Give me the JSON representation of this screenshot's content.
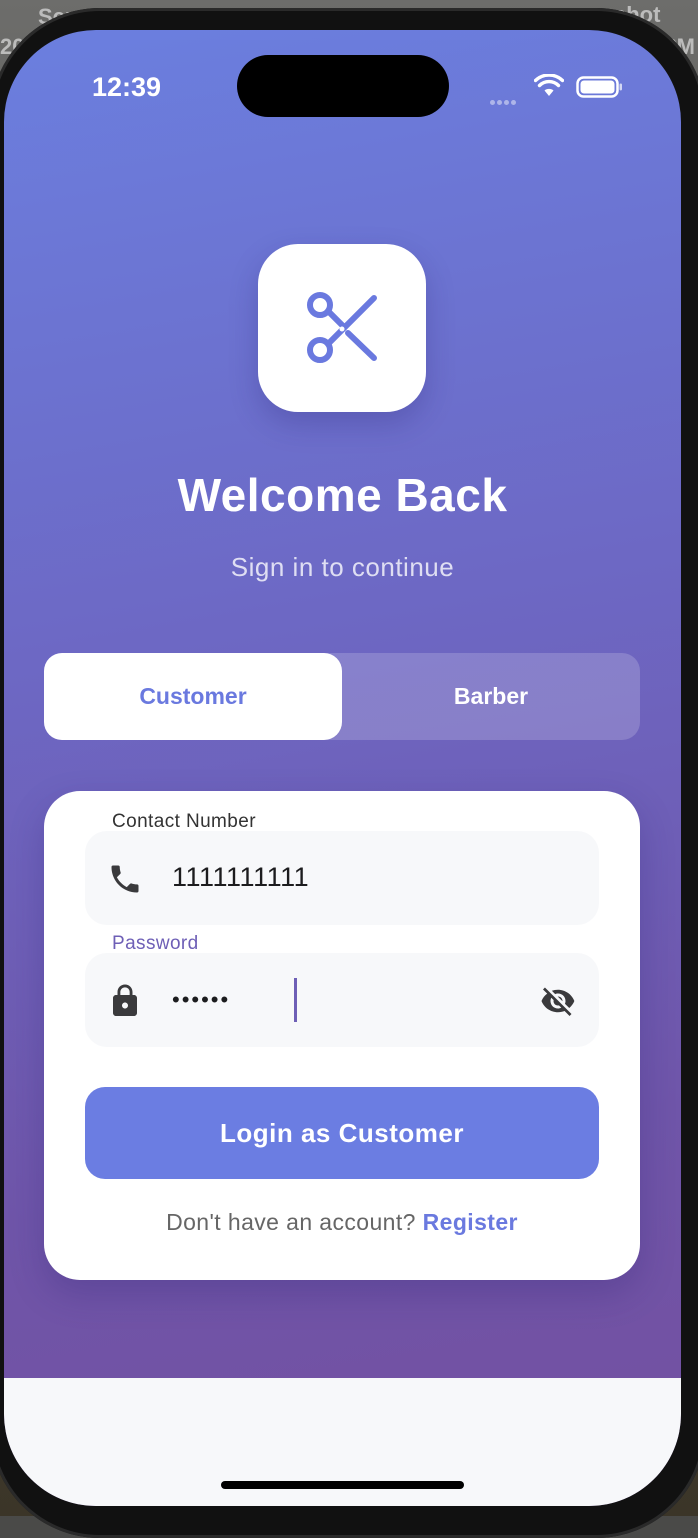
{
  "background": {
    "fragment_top_left": "Scr",
    "fragment_left": "20",
    "fragment_top_right": "shot",
    "fragment_right": "PM"
  },
  "status_bar": {
    "time": "12:39"
  },
  "header": {
    "logo_icon": "scissors-icon",
    "title": "Welcome Back",
    "subtitle": "Sign in to continue"
  },
  "role_toggle": {
    "options": [
      {
        "label": "Customer",
        "selected": true
      },
      {
        "label": "Barber",
        "selected": false
      }
    ]
  },
  "form": {
    "contact_field": {
      "label": "Contact Number",
      "value": "1111111111",
      "icon": "phone-icon"
    },
    "password_field": {
      "label": "Password",
      "value": "••••••",
      "icon": "lock-icon",
      "toggle_icon": "eye-off-icon"
    },
    "login_button": "Login as Customer",
    "register_prompt": "Don't have an account?",
    "register_link": "Register"
  },
  "colors": {
    "accent": "#6a79df",
    "gradient_top": "#6b7fdf",
    "gradient_bottom": "#7450a0",
    "focus": "#6e5fb6"
  }
}
